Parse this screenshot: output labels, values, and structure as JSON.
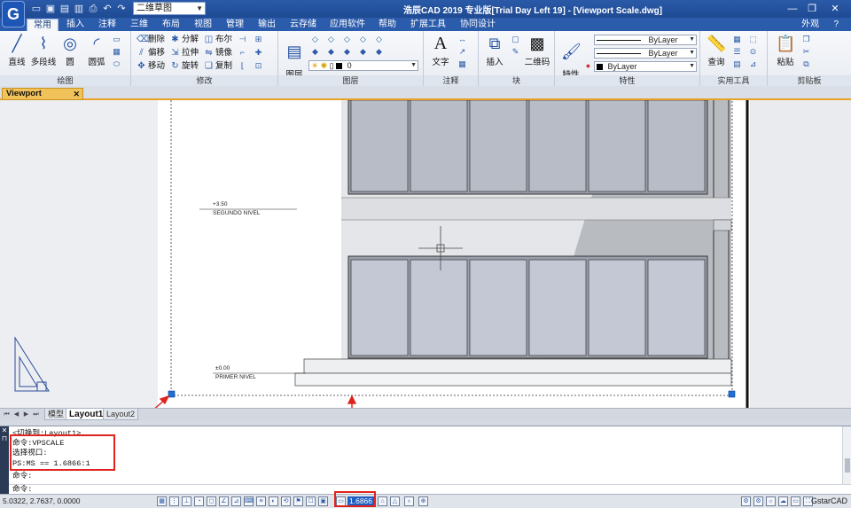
{
  "titlebar": {
    "workspace": "二维草图",
    "title": "浩辰CAD 2019 专业版[Trial Day Left 19] - [Viewport Scale.dwg]",
    "logo_letter": "G"
  },
  "ribbon_tabs": [
    "常用",
    "插入",
    "注释",
    "三维",
    "布局",
    "视图",
    "管理",
    "输出",
    "云存储",
    "应用软件",
    "帮助",
    "扩展工具",
    "协同设计"
  ],
  "view_mode": "外观",
  "panels": {
    "draw": {
      "title": "绘图",
      "buttons": [
        "直线",
        "多段线",
        "圆",
        "圆弧"
      ]
    },
    "modify": {
      "title": "修改",
      "items": [
        "删除",
        "分解",
        "布尔",
        "偏移",
        "拉伸",
        "镜像",
        "移动",
        "旋转",
        "复制"
      ]
    },
    "layer": {
      "title": "图层",
      "button": "图层\n特性",
      "current_layer": "0"
    },
    "annotation": {
      "title": "注释",
      "button": "文字"
    },
    "block": {
      "title": "块",
      "buttons": [
        "插入",
        "二维码"
      ]
    },
    "properties": {
      "title": "特性",
      "button": "特性\n匹配",
      "color": "ByLayer",
      "linetype": "ByLayer",
      "lineweight": "ByLayer"
    },
    "utilities": {
      "title": "实用工具",
      "button": "查询"
    },
    "clipboard": {
      "title": "剪贴板",
      "button": "粘贴"
    }
  },
  "document": {
    "tab_name": "Viewport Scale.dwg"
  },
  "drawing": {
    "level_upper_value": "+3.50",
    "level_upper_name": "SEGUNDO NIVEL",
    "level_lower_value": "±0.00",
    "level_lower_name": "PRIMER NIVEL"
  },
  "layout_tabs": [
    "模型",
    "Layout1",
    "Layout2"
  ],
  "active_layout": "Layout1",
  "command": {
    "lines": [
      "<切换到:Layout1>",
      "命令:VPSCALE",
      "选择视口:",
      "PS:MS == 1.6866:1",
      "命令:",
      "命令:"
    ]
  },
  "statusbar": {
    "coords": "5.0322, 2.7637, 0.0000",
    "viewport_scale": "1.6866",
    "brand": "GstarCAD"
  },
  "colors": {
    "title_blue": "#1f4a94",
    "highlight_red": "#e0231c",
    "doc_tab_orange": "#f2c25a",
    "grip_blue": "#1f6fd8"
  }
}
